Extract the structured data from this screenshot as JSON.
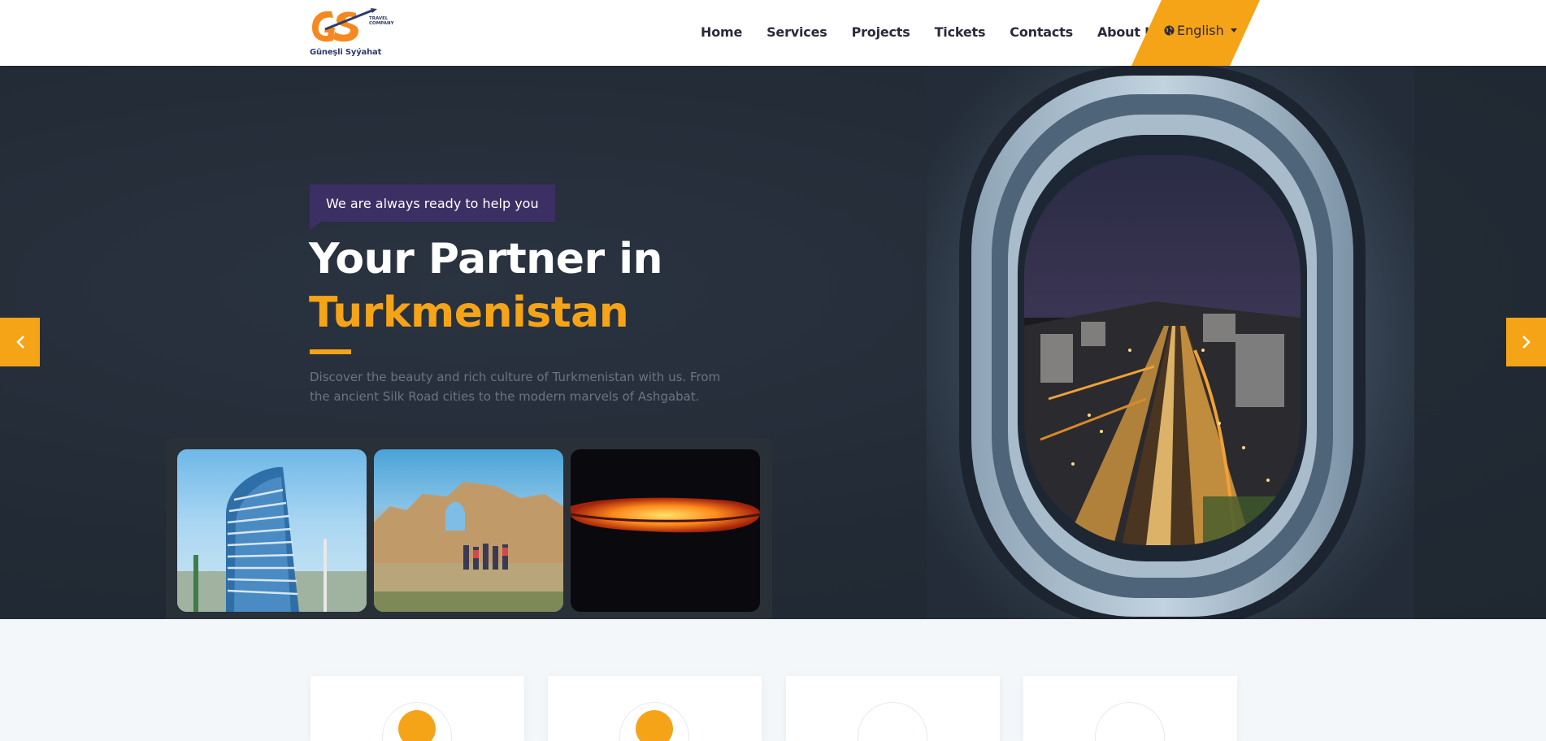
{
  "brand": {
    "logo_letters": "GS",
    "logo_sub": "TRAVEL COMPANY",
    "name": "Güneşli Syýahat",
    "accent_color": "#f5a418",
    "secondary_color": "#3b2f63"
  },
  "nav": {
    "items": [
      {
        "label": "Home"
      },
      {
        "label": "Services"
      },
      {
        "label": "Projects"
      },
      {
        "label": "Tickets"
      },
      {
        "label": "Contacts"
      },
      {
        "label": "About Us"
      }
    ],
    "language": {
      "label": "English",
      "icon": "globe-icon"
    }
  },
  "hero": {
    "tag": "We are always ready to help you",
    "title_line1": "Your Partner in",
    "title_line2": "Turkmenistan",
    "description": "Discover the beauty and rich culture of Turkmenistan with us. From the ancient Silk Road cities to the modern marvels of Ashgabat.",
    "gallery": [
      {
        "subject": "modern glass tower"
      },
      {
        "subject": "ancient fortress ruins with tourists"
      },
      {
        "subject": "Darvaza gas crater at night"
      }
    ],
    "feature_image": "airplane window with night city view",
    "prev_icon": "chevron-left-icon",
    "next_icon": "chevron-right-icon"
  },
  "features": {
    "cards": [
      {
        "icon_color": "#f5a418"
      },
      {
        "icon_color": "#f5a418"
      },
      {
        "icon_color": "#ffffff"
      },
      {
        "icon_color": "#ffffff"
      }
    ]
  }
}
